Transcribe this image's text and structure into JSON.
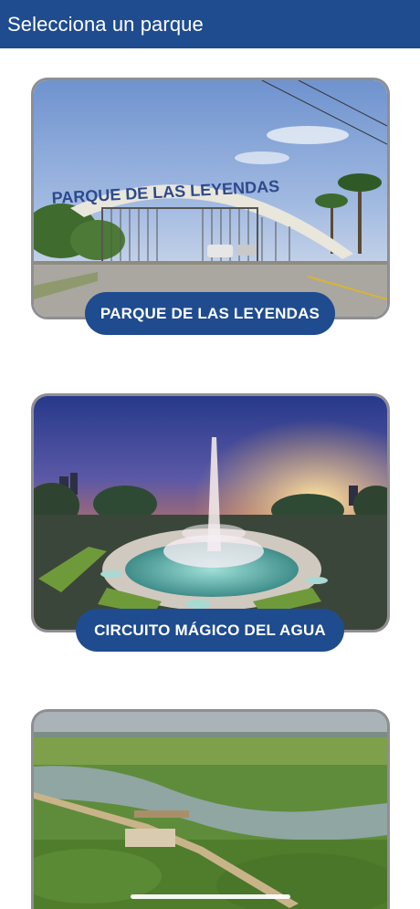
{
  "header": {
    "title": "Selecciona un parque"
  },
  "parks": [
    {
      "label": "PARQUE DE LAS LEYENDAS",
      "sign": "PARQUE DE LAS LEYENDAS"
    },
    {
      "label": "CIRCUITO MÁGICO DEL AGUA"
    },
    {
      "label": ""
    }
  ],
  "colors": {
    "primary": "#1f4b8f",
    "card_border": "#8e8e93"
  }
}
